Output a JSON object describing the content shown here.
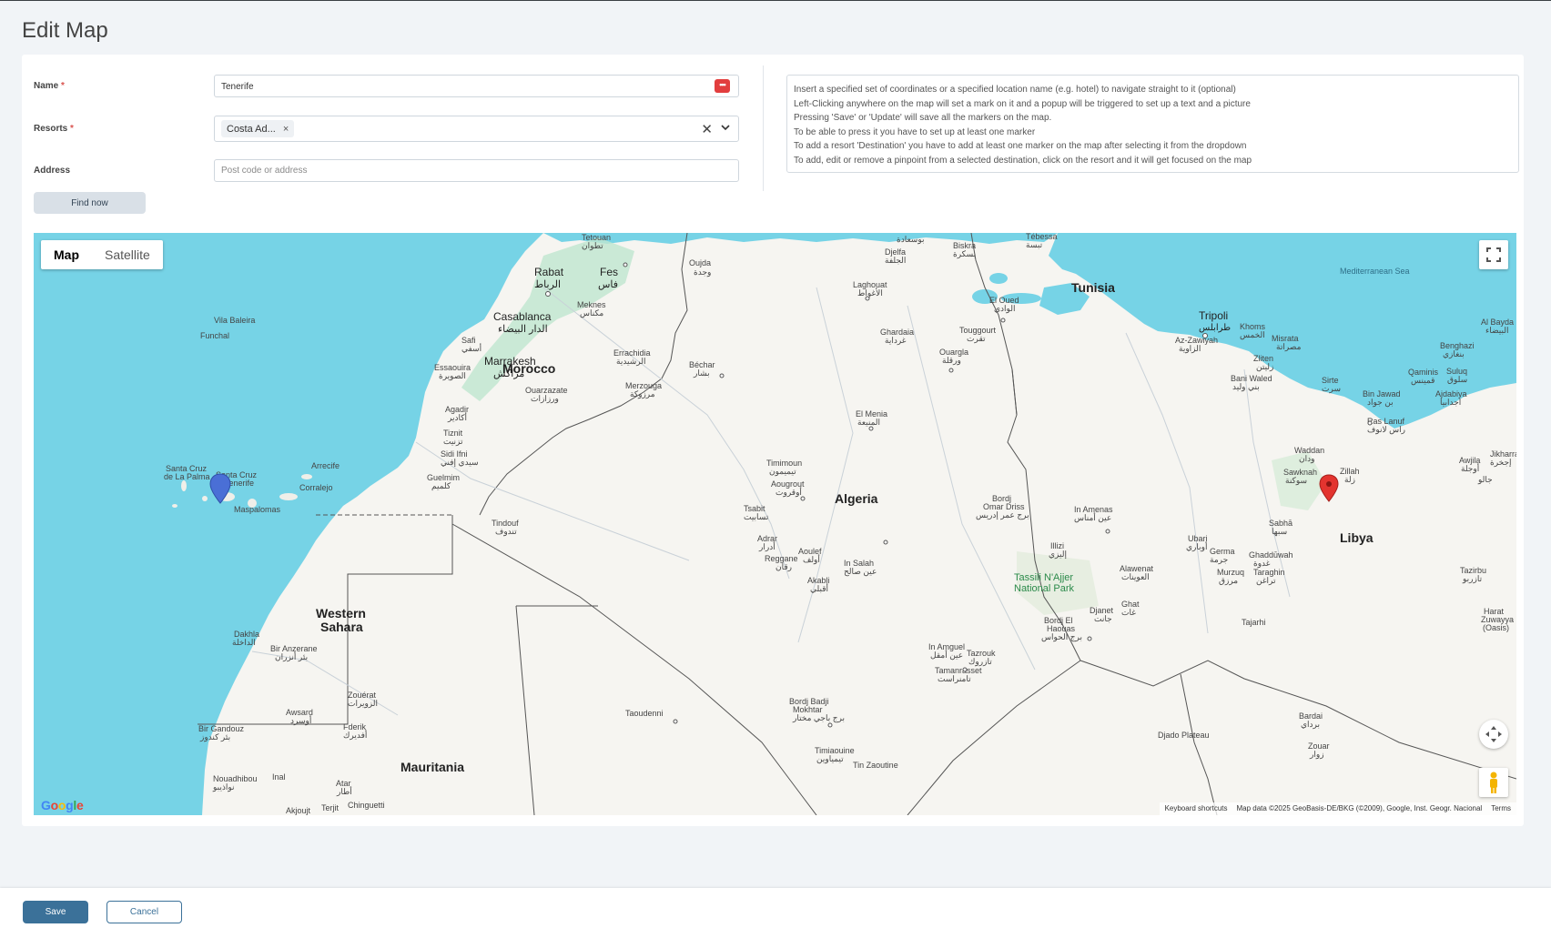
{
  "page": {
    "title": "Edit Map"
  },
  "form": {
    "name_label": "Name",
    "required_mark": "*",
    "name_value": "Tenerife",
    "resorts_label": "Resorts",
    "resort_chip": "Costa Ad...",
    "chip_remove": "×",
    "clear_icon": "✕",
    "address_label": "Address",
    "address_placeholder": "Post code or address",
    "find_button": "Find now",
    "name_action_icon": "•••"
  },
  "info": {
    "lines": [
      "Insert a specified set of coordinates or a specified location name (e.g. hotel) to navigate straight to it (optional)",
      "Left-Clicking anywhere on the map will set a mark on it and a popup will be triggered to set up a text and a picture",
      "Pressing 'Save' or 'Update' will save all the markers on the map.",
      "To be able to press it you have to set up at least one marker",
      "To add a resort 'Destination' you have to add at least one marker on the map after selecting it from the dropdown",
      "To add, edit or remove a pinpoint from a selected destination, click on the resort and it will get focused on the map"
    ]
  },
  "map": {
    "type_map": "Map",
    "type_satellite": "Satellite",
    "google": "Google",
    "attribution": {
      "shortcuts": "Keyboard shortcuts",
      "data": "Map data ©2025 GeoBasis-DE/BKG (©2009), Google, Inst. Geogr. Nacional",
      "terms": "Terms"
    },
    "colors": {
      "water": "#76d3e6",
      "land": "#f6f5f1",
      "marker_blue": "#4a6fd6",
      "marker_red": "#e3342f"
    },
    "countries": {
      "morocco": "Morocco",
      "algeria": "Algeria",
      "tunisia": "Tunisia",
      "libya": "Libya",
      "western_sahara_1": "Western",
      "western_sahara_2": "Sahara",
      "mauritania": "Mauritania"
    },
    "seas": {
      "med": "Mediterranean Sea"
    },
    "parks": {
      "tassili_1": "Tassili N'Ajjer",
      "tassili_2": "National Park"
    },
    "cities": {
      "tetouan": "Tetouan",
      "tetouan_ar": "تطوان",
      "rabat": "Rabat",
      "rabat_ar": "الرباط",
      "fes": "Fes",
      "fes_ar": "فاس",
      "oujda": "Oujda",
      "oujda_ar": "وجدة",
      "casablanca": "Casablanca",
      "casablanca_ar": "الدار البيضاء",
      "meknes": "Meknes",
      "meknes_ar": "مكناس",
      "safi": "Safi",
      "safi_ar": "أسفي",
      "marrakesh": "Marrakesh",
      "marrakesh_ar": "مراكش",
      "essaouira": "Essaouira",
      "essaouira_ar": "الصويرة",
      "errachidia": "Errachidia",
      "errachidia_ar": "الرشيدية",
      "bechar": "Béchar",
      "bechar_ar": "بشار",
      "ouarzazate": "Ouarzazate",
      "ouarzazate_ar": "ورزازات",
      "merzouga": "Merzouga",
      "merzouga_ar": "مرزوكة",
      "agadir": "Agadir",
      "agadir_ar": "أكادير",
      "tiznit": "Tiznit",
      "tiznit_ar": "تزنيت",
      "sidiifni": "Sidi Ifni",
      "sidiifni_ar": "سيدي إفني",
      "guelmim": "Guelmim",
      "guelmim_ar": "كلميم",
      "tindouf": "Tindouf",
      "tindouf_ar": "تندوف",
      "vilabaleira": "Vila Baleira",
      "funchal": "Funchal",
      "santacruzpalma_1": "Santa Cruz",
      "santacruzpalma_2": "de La Palma",
      "santacruztf_1": "Santa Cruz",
      "santacruztf_2": "Tenerife",
      "arrecife": "Arrecife",
      "corralejo": "Corralejo",
      "maspalomas": "Maspalomas",
      "djelfa": "Djelfa",
      "djelfa_ar": "الجلفة",
      "biskra": "Biskra",
      "biskra_ar": "بسكرة",
      "tebessa": "Tébessa",
      "tebessa_ar": "تبسة",
      "bousaada_ar": "بوسعادة",
      "laghouat": "Laghouat",
      "laghouat_ar": "الأغواط",
      "eloued": "El Oued",
      "eloued_ar": "الوادي",
      "touggourt": "Touggourt",
      "touggourt_ar": "تقرت",
      "ghardaia": "Ghardaia",
      "ghardaia_ar": "غرداية",
      "ouargla": "Ouargla",
      "ouargla_ar": "ورقلة",
      "elmenia": "El Menia",
      "elmenia_ar": "المنيعة",
      "timimoun": "Timimoun",
      "timimoun_ar": "تيميمون",
      "aougrout": "Aougrout",
      "aougrout_ar": "أوقروت",
      "tsabit": "Tsabit",
      "tsabit_ar": "تسابيت",
      "adrar": "Adrar",
      "adrar_ar": "أدرار",
      "aoulef": "Aoulef",
      "aoulef_ar": "أولف",
      "reggane": "Reggane",
      "reggane_ar": "رقان",
      "insalah": "In Salah",
      "insalah_ar": "عين صالح",
      "akabli": "Akabli",
      "akabli_ar": "أقبلي",
      "bordjomar_1": "Bordj",
      "bordjomar_2": "Omar Driss",
      "bordjomar_ar": "برج عمر إدريس",
      "inamenas": "In Amenas",
      "inamenas_ar": "عين أمناس",
      "illizi": "Illizi",
      "illizi_ar": "إليزي",
      "djanet": "Djanet",
      "djanet_ar": "جانت",
      "bordjelhaouas_1": "Bordj El",
      "bordjelhaouas_2": "Haouas",
      "bordjelhaouas_ar": "برج الحواس",
      "inamguel": "In Amguel",
      "inamguel_ar": "عين أمقل",
      "tazrouk": "Tazrouk",
      "tazrouk_ar": "تازروك",
      "tamanrasset": "Tamanrasset",
      "tamanrasset_ar": "تامنراست",
      "bordjbadji_1": "Bordj Badji",
      "bordjbadji_2": "Mokhtar",
      "bordjbadji_ar": "برج باجي مختار",
      "timiaouine": "Timiaouine",
      "timiaouine_ar": "تيمياوين",
      "tinzaoutine": "Tin Zaoutine",
      "tripoli": "Tripoli",
      "tripoli_ar": "طرابلس",
      "khoms": "Khoms",
      "khoms_ar": "الخمس",
      "misrata": "Misrata",
      "misrata_ar": "مصراتة",
      "azzawiyah": "Az-Zawiyah",
      "azzawiyah_ar": "الزاوية",
      "zliten": "Zliten",
      "zliten_ar": "زليتن",
      "baniwaled": "Bani Waled",
      "baniwaled_ar": "بني وليد",
      "sirte": "Sirte",
      "sirte_ar": "سرت",
      "binjawad": "Bin Jawad",
      "binjawad_ar": "بن جواد",
      "raslanuf": "Ras Lanuf",
      "raslanuf_ar": "راس لانوف",
      "albayda": "Al Bayda",
      "albayda_ar": "البيضاء",
      "benghazi": "Benghazi",
      "benghazi_ar": "بنغازي",
      "qaminis": "Qaminis",
      "qaminis_ar": "قمينس",
      "suluq": "Suluq",
      "suluq_ar": "سلوق",
      "ajdabiya": "Ajdabiya",
      "ajdabiya_ar": "اجدابيا",
      "waddan": "Waddan",
      "waddan_ar": "ودان",
      "sawknah": "Sawknah",
      "sawknah_ar": "سوكنة",
      "zillah": "Zillah",
      "zillah_ar": "زلة",
      "awjila": "Awjila",
      "awjila_ar": "أوجلة",
      "jikharra": "Jikharra",
      "jikharra_ar": "إجخرة",
      "jalu_ar": "جالو",
      "sabha": "Sabhā",
      "sabha_ar": "سبها",
      "ubari": "Ubari",
      "ubari_ar": "أوباري",
      "germa": "Germa",
      "germa_ar": "جرمة",
      "ghaddwah": "Ghaddūwah",
      "ghaddwah_ar": "غدوة",
      "murzuq": "Murzuq",
      "murzuq_ar": "مرزق",
      "taraghin": "Taraghin",
      "taraghin_ar": "تراغن",
      "alawenat": "Alawenat",
      "alawenat_ar": "العوينات",
      "ghat": "Ghat",
      "ghat_ar": "غات",
      "tajarhi": "Tajarhi",
      "tazirbu": "Tazirbu",
      "tazirbu_ar": "تازربو",
      "harat_1": "Harat",
      "harat_2": "Zuwayya",
      "harat_3": "(Oasis)",
      "djado": "Djado Plateau",
      "bardai": "Bardai",
      "bardai_ar": "برداي",
      "zouar": "Zouar",
      "zouar_ar": "زوار",
      "dakhla": "Dakhla",
      "dakhla_ar": "الداخلة",
      "biranzerane": "Bir Anzerane",
      "biranzerane_ar": "بئر أنزران",
      "awsard": "Awsard",
      "awsard_ar": "أوسرد",
      "zouerat": "Zouérat",
      "zouerat_ar": "الزويرات",
      "fderik": "Fderik",
      "fderik_ar": "أفديرك",
      "birgandouz": "Bir Gandouz",
      "birgandouz_ar": "بئر كندوز",
      "nouadhibou": "Nouadhibou",
      "nouadhibou_ar": "نواذيبو",
      "inal": "Inal",
      "atar": "Atar",
      "atar_ar": "أطار",
      "chinguetti": "Chinguetti",
      "akjoujt": "Akjoujt",
      "terjit": "Terjit",
      "taoudenni": "Taoudenni"
    }
  },
  "footer": {
    "save": "Save",
    "cancel": "Cancel"
  }
}
